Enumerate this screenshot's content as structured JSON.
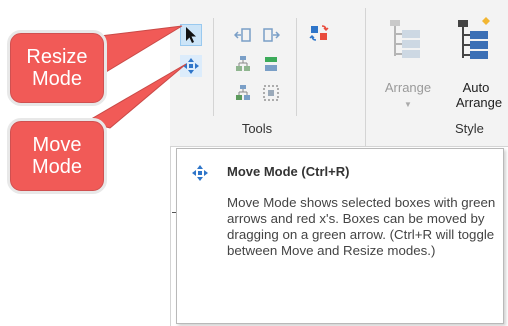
{
  "callouts": {
    "resize": "Resize Mode",
    "move": "Move Mode"
  },
  "ribbon": {
    "tools_group_label": "Tools",
    "style_group_label": "Style",
    "arrange_label": "Arrange",
    "auto_arrange_line1": "Auto",
    "auto_arrange_line2": "Arrange"
  },
  "tooltip": {
    "title": "Move Mode (Ctrl+R)",
    "body": "Move Mode shows selected boxes with green arrows and red x's. Boxes can be moved by dragging on a green arrow. (Ctrl+R will toggle between Move and Resize modes.)"
  },
  "icons": {
    "resize_mode": "cursor-arrow-icon",
    "move_mode": "move-arrows-icon",
    "accent_blue": "#2e75c9",
    "accent_green": "#3cab5a",
    "callout_red": "#f15a57"
  }
}
